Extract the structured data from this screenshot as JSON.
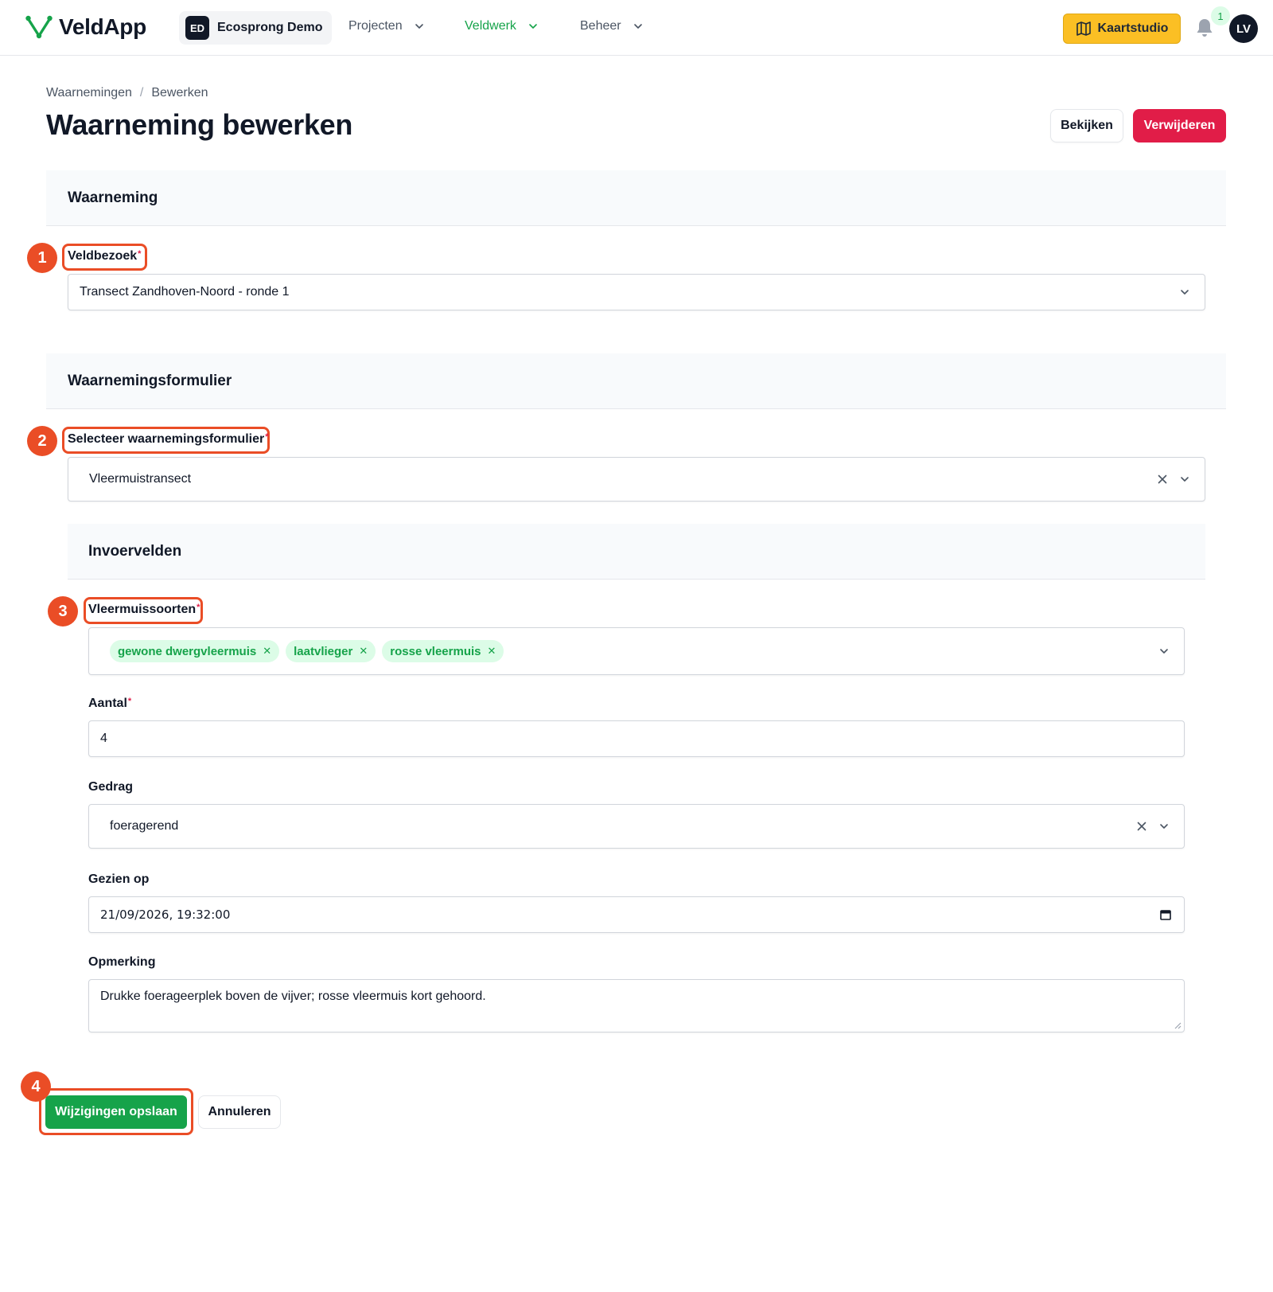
{
  "app": {
    "name": "VeldApp"
  },
  "org": {
    "initials": "ED",
    "name": "Ecosprong Demo"
  },
  "nav": {
    "items": [
      {
        "label": "Projecten",
        "active": false
      },
      {
        "label": "Veldwerk",
        "active": true
      },
      {
        "label": "Beheer",
        "active": false
      }
    ],
    "map_button": "Kaartstudio",
    "notification_count": "1",
    "user_initials": "LV"
  },
  "breadcrumb": [
    "Waarnemingen",
    "Bewerken"
  ],
  "breadcrumb_separator": "/",
  "page_title": "Waarneming bewerken",
  "actions": {
    "view": "Bekijken",
    "delete": "Verwijderen"
  },
  "section_observation": {
    "title": "Waarneming",
    "field_label": "Veldbezoek",
    "value": "Transect Zandhoven-Noord - ronde 1"
  },
  "section_form": {
    "title": "Waarnemingsformulier",
    "field_label": "Selecteer waarnemingsformulier",
    "value": "Vleermuistransect"
  },
  "input_fields": {
    "title": "Invoervelden",
    "species": {
      "label": "Vleermuissoorten",
      "chips": [
        "gewone dwergvleermuis",
        "laatvlieger",
        "rosse vleermuis"
      ]
    },
    "count": {
      "label": "Aantal",
      "value": "4"
    },
    "behaviour": {
      "label": "Gedrag",
      "value": "foeragerend"
    },
    "seen_on": {
      "label": "Gezien op",
      "value": "21/09/2026, 19:32:00"
    },
    "remark": {
      "label": "Opmerking",
      "value": "Drukke foerageerplek boven de vijver; rosse vleermuis kort gehoord."
    }
  },
  "required_marker": "*",
  "steps": [
    "1",
    "2",
    "3",
    "4"
  ],
  "footer": {
    "save": "Wijzigingen opslaan",
    "cancel": "Annuleren"
  },
  "colors": {
    "brand_green": "#16a34a",
    "chip_bg": "#dcfce7",
    "delete_red": "#e11d48",
    "map_button_yellow": "#fbbf24",
    "annotation_orange": "#ea4d26"
  }
}
